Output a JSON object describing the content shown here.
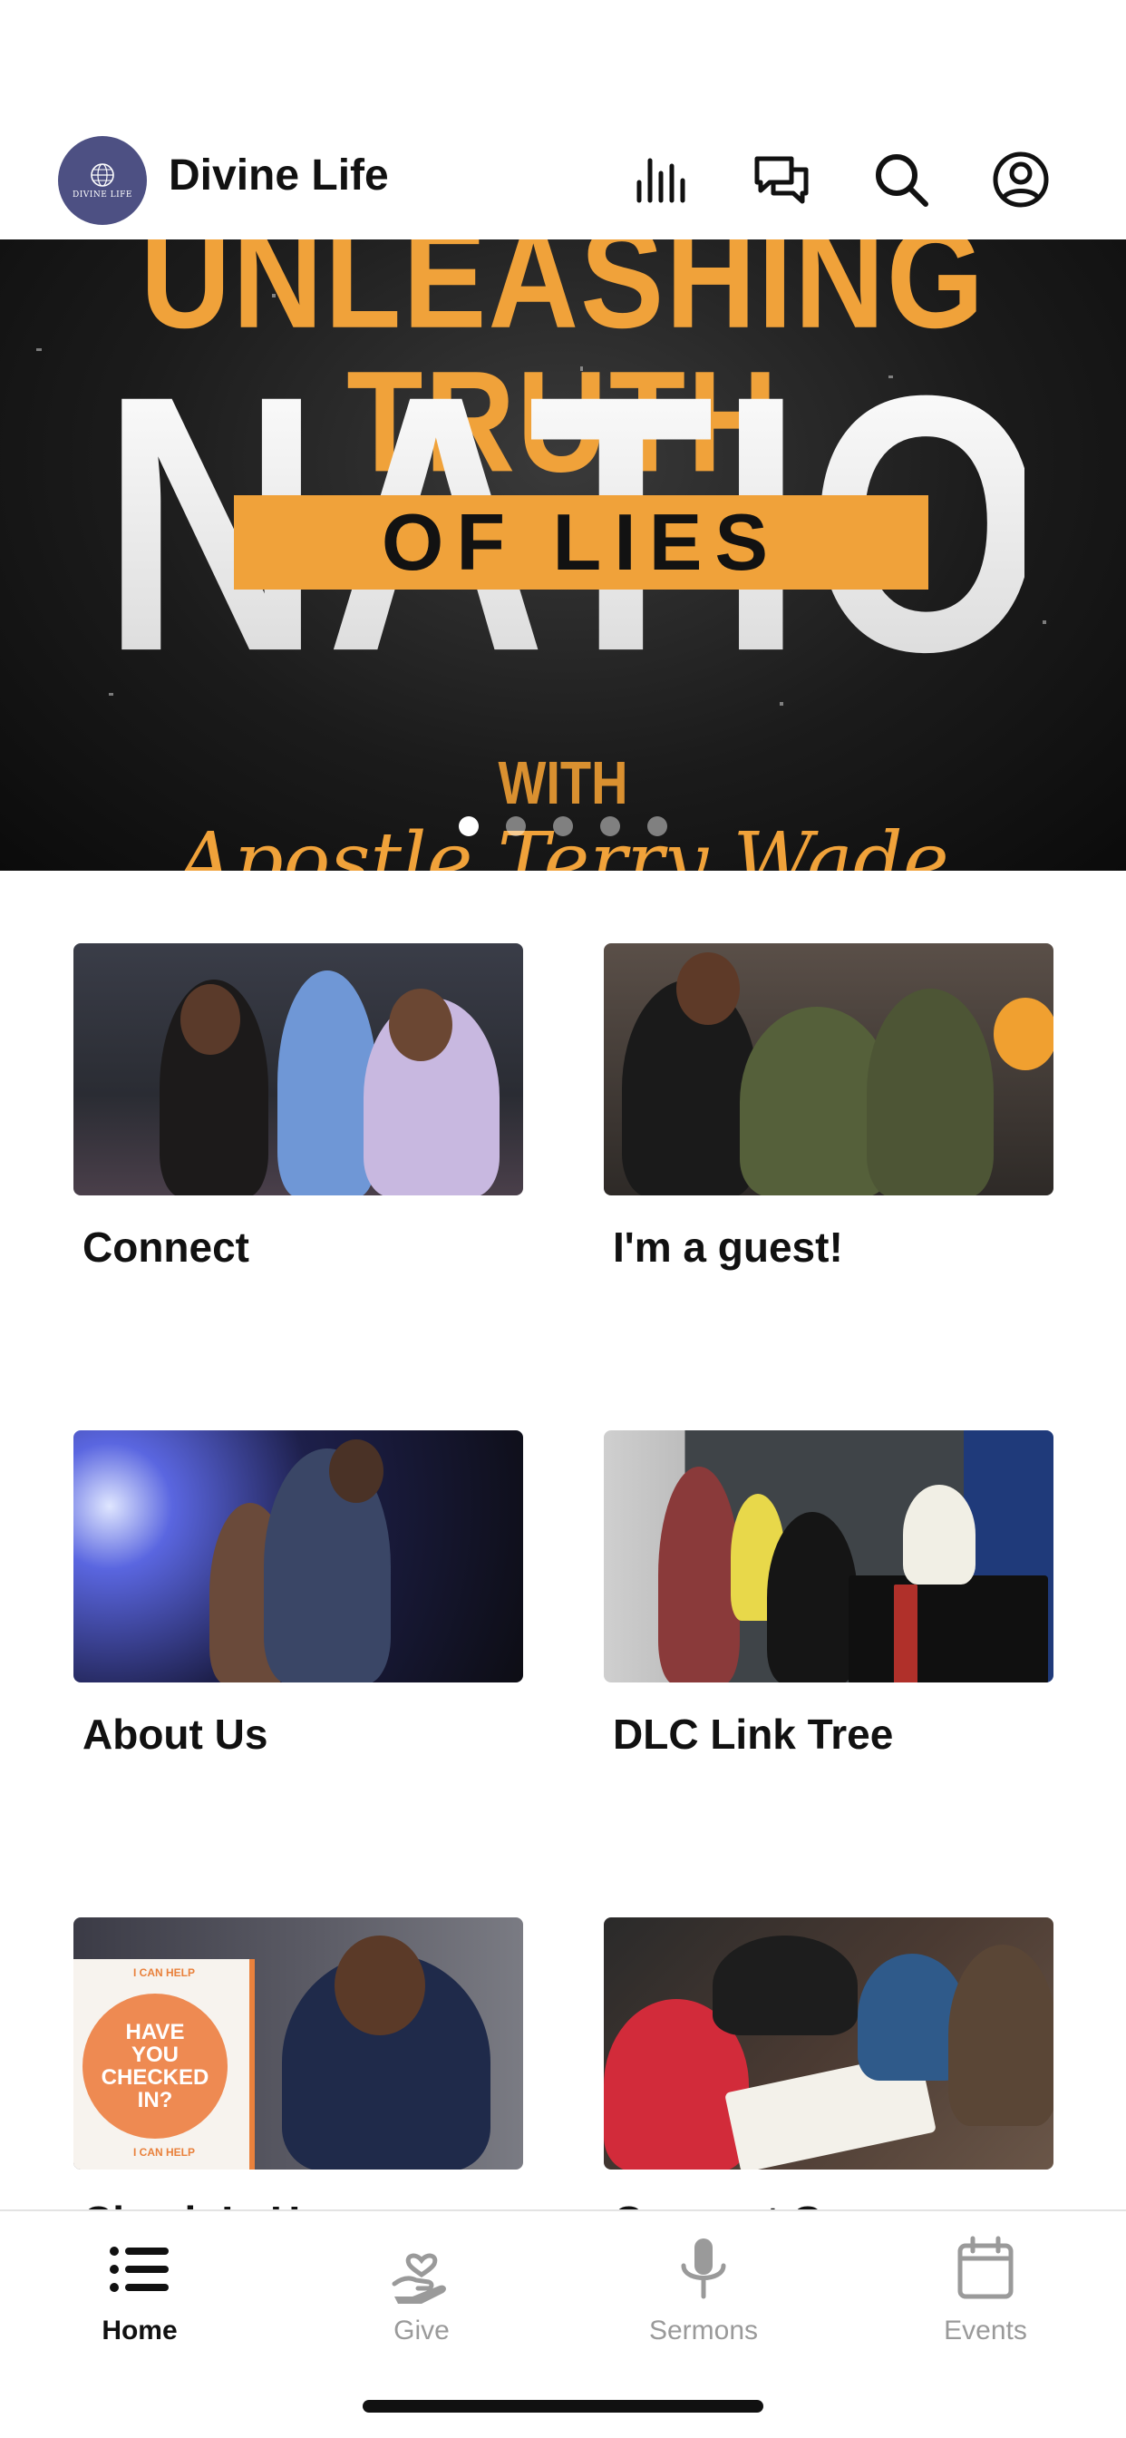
{
  "header": {
    "app_name": "Divine Life",
    "logo_text": "DIVINE LIFE",
    "icons": [
      "audio-bars-icon",
      "chat-bubbles-icon",
      "search-icon",
      "profile-icon"
    ]
  },
  "hero": {
    "line1": "UNLEASHING TRUTH",
    "big_word": "NATION",
    "band_text": "OF LIES",
    "with_text": "WITH",
    "script_text": "Apostle Terry Wade",
    "slide_count": 5,
    "active_slide": 1
  },
  "tiles": [
    {
      "label": "Connect"
    },
    {
      "label": "I'm a guest!"
    },
    {
      "label": "About Us"
    },
    {
      "label": "DLC Link Tree"
    },
    {
      "label": "Check-In Here",
      "poster_lines": [
        "I CAN HELP",
        "HAVE",
        "YOU",
        "CHECKED",
        "IN?",
        "I CAN HELP"
      ]
    },
    {
      "label": "Connect Group"
    }
  ],
  "tabbar": {
    "items": [
      {
        "label": "Home",
        "icon": "list-icon",
        "active": true
      },
      {
        "label": "Give",
        "icon": "hand-heart-icon",
        "active": false
      },
      {
        "label": "Sermons",
        "icon": "microphone-icon",
        "active": false
      },
      {
        "label": "Events",
        "icon": "calendar-icon",
        "active": false
      }
    ]
  },
  "colors": {
    "accent_orange": "#f0a23a",
    "logo_bg": "#4d5083",
    "tab_inactive": "#9a9a9a"
  }
}
